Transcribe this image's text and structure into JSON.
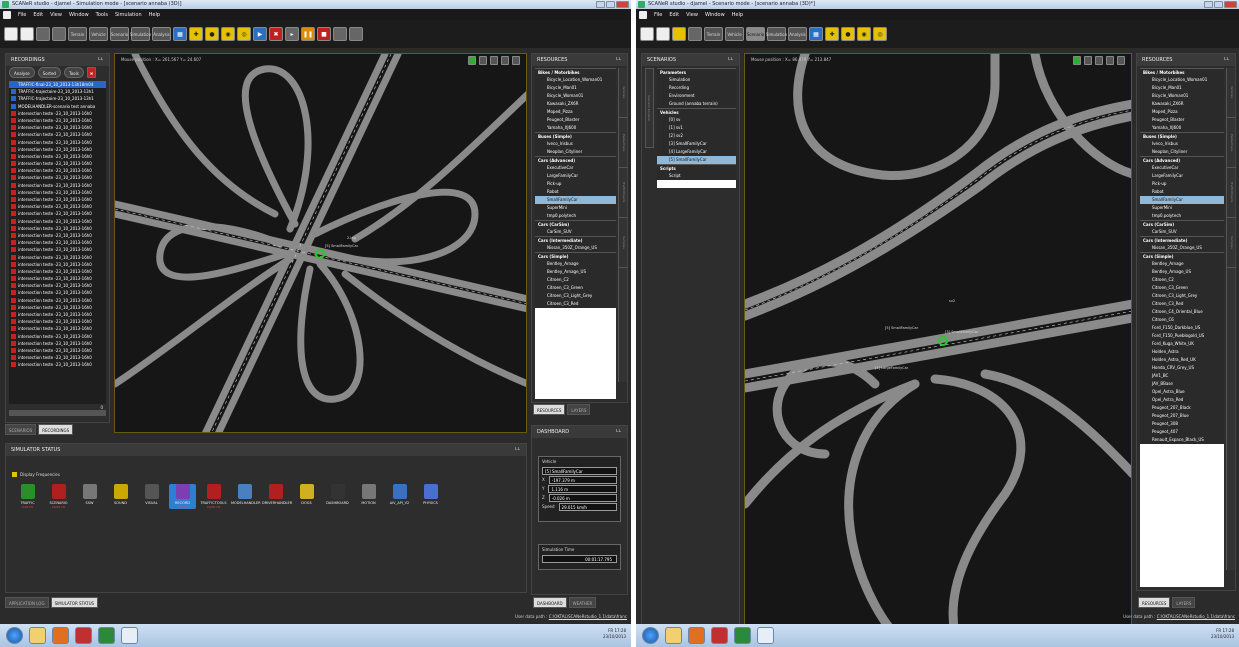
{
  "left": {
    "title": "SCANeR studio - djamel - Simulation mode - [scenario annaba (3D)]",
    "menu": [
      "File",
      "Edit",
      "View",
      "Window",
      "Tools",
      "Simulation",
      "Help"
    ],
    "toolbar_modes": [
      "Terrain",
      "Vehicle",
      "Scenario",
      "Simulation",
      "Analysis"
    ],
    "recordings": {
      "header": "RECORDINGS",
      "buttons": [
        "Analyse",
        "Sorted",
        "Tools"
      ],
      "items": [
        "TRAFFIC-final-23_10_2013-13h18m04",
        "TRAFFIC-trajectoire-23_10_2013-13h1",
        "TRAFFIC-trajectoire-23_10_2013-13h1",
        "MODELHANDLER-scenario test annaba",
        "intersection teste -23_10_2013-16h0",
        "intersection teste -23_10_2013-16h0",
        "intersection teste -23_10_2013-16h0",
        "intersection teste -23_10_2013-16h0",
        "intersection teste -23_10_2013-16h0",
        "intersection teste -23_10_2013-16h0",
        "intersection teste -23_10_2013-16h0",
        "intersection teste -23_10_2013-16h0",
        "intersection teste -23_10_2013-16h0",
        "intersection teste -23_10_2013-16h0",
        "intersection teste -23_10_2013-16h0",
        "intersection teste -23_10_2013-16h0",
        "intersection teste -23_10_2013-16h0",
        "intersection teste -23_10_2013-16h0",
        "intersection teste -23_10_2013-16h0",
        "intersection teste -23_10_2013-16h0",
        "intersection teste -23_10_2013-16h0",
        "intersection teste -23_10_2013-16h0",
        "intersection teste -23_10_2013-16h0",
        "intersection teste -23_10_2013-16h0",
        "intersection teste -23_10_2013-16h0",
        "intersection teste -23_10_2013-16h0",
        "intersection teste -23_10_2013-16h0",
        "intersection teste -23_10_2013-16h0",
        "intersection teste -23_10_2013-16h0",
        "intersection teste -23_10_2013-16h0",
        "intersection teste -23_10_2013-16h0",
        "intersection teste -23_10_2013-16h0",
        "intersection teste -23_10_2013-16h0",
        "intersection teste -23_10_2013-16h0",
        "intersection teste -23_10_2013-16h0",
        "intersection teste -23_10_2013-16h0",
        "intersection teste -23_10_2013-16h0",
        "intersection teste -23_10_2013-16h0",
        "intersection teste -23_10_2013-16h0",
        "intersection teste -23_10_2013-16h0"
      ],
      "scroll_value": "0"
    },
    "left_tabs": [
      "SCENARIOS",
      "RECORDINGS"
    ],
    "mouse_position": "Mouse position :  X= 261.567    Y= 24.607",
    "scene_labels": [
      "2.lag",
      "[5] SmallFamilyCar"
    ],
    "resources": {
      "header": "RESOURCES",
      "groups": [
        {
          "name": "Bikes / Motorbikes",
          "items": [
            "Bicycle_Location_Woman01",
            "Bicycle_Man01",
            "Bicycle_Woman01",
            "Kawasaki_ZX6R",
            "Moped_Pizza",
            "Peugeot_Blaster",
            "Yamaha_XJ600"
          ]
        },
        {
          "name": "Buses (Simple)",
          "items": [
            "Iveco_Irisbus",
            "Neoplan_Cityliner"
          ]
        },
        {
          "name": "Cars (Advanced)",
          "items": [
            "ExecutiveCar",
            "LargeFamilyCar",
            "Pick-up",
            "Robot",
            "SmallFamilyCar",
            "SuperMini",
            "tmp0.polytech"
          ]
        },
        {
          "name": "Cars (CarSim)",
          "items": [
            "CarSim_SUV"
          ]
        },
        {
          "name": "Cars (Intermediate)",
          "items": [
            "Nissan_350Z_Orange_US"
          ]
        },
        {
          "name": "Cars (Simple)",
          "items": [
            "Bentley_Arnage",
            "Bentley_Arnage_US",
            "Citroen_C2",
            "Citroen_C3_Green",
            "Citroen_C3_Light_Grey",
            "Citroen_C3_Red"
          ]
        }
      ],
      "selected": "SmallFamilyCar",
      "vtabs": [
        "Vehicles",
        "Pedestrians",
        "TrafficObjects",
        "Samples"
      ],
      "tabs": [
        "RESOURCES",
        "LAYERS"
      ]
    },
    "simulator": {
      "header": "SIMULATOR STATUS",
      "display_freq": "Display Frequencies",
      "modules": [
        {
          "name": "TRAFFIC",
          "hz": "4.00 Hz",
          "color": "#2a8f2a"
        },
        {
          "name": "SCENARIO",
          "hz": "20/20 Hz",
          "color": "#b02020"
        },
        {
          "name": "SSW",
          "hz": "",
          "color": "#777777"
        },
        {
          "name": "SOUND",
          "hz": "",
          "color": "#caa800"
        },
        {
          "name": "VISUAL",
          "hz": "",
          "color": "#555555"
        },
        {
          "name": "RECORD",
          "hz": "100 Hz",
          "color": "#7a3fb0"
        },
        {
          "name": "TRAFFICTOOLS",
          "hz": "20/20 Hz",
          "color": "#b02020"
        },
        {
          "name": "MODELHANDLER",
          "hz": "",
          "color": "#4a80c0"
        },
        {
          "name": "DRIVERHANDLER",
          "hz": "",
          "color": "#b02020"
        },
        {
          "name": "DOGS",
          "hz": "",
          "color": "#d0b020"
        },
        {
          "name": "DASHBOARD",
          "hz": "",
          "color": "#333333"
        },
        {
          "name": "MOTION",
          "hz": "",
          "color": "#777777"
        },
        {
          "name": "AIV_API_V2",
          "hz": "",
          "color": "#3a70c0"
        },
        {
          "name": "PHYSICS",
          "hz": "",
          "color": "#4a6fd0"
        }
      ],
      "tabs": [
        "APPLICATION LOG",
        "SIMULATOR STATUS"
      ]
    },
    "dashboard": {
      "header": "DASHBOARD",
      "vehicle_label": "Vehicle",
      "vehicle": "[5] SmallFamilyCar",
      "x_label": "X",
      "x": "-197.379 m",
      "y_label": "Y",
      "y": "1.116 m",
      "z_label": "Z",
      "z": "-0.026 m",
      "speed_label": "Speed",
      "speed": "29.015 km/h",
      "time_label": "Simulation Time",
      "time": "00:01:17.795",
      "tabs": [
        "DASHBOARD",
        "WEATHER"
      ]
    },
    "user_path_label": "User data path : ",
    "user_path": "C:\\OKTAL\\SCANeRstudio_1.1\\data\\franc",
    "tray": {
      "lang": "FR",
      "time": "17:28",
      "date": "23/10/2013"
    }
  },
  "right": {
    "title": "SCANeR studio - djamel - Scenario mode - [scenario annaba (3D)*]",
    "menu": [
      "File",
      "Edit",
      "View",
      "Window",
      "Help"
    ],
    "toolbar_modes": [
      "Terrain",
      "Vehicle",
      "Scenario",
      "Simulation",
      "Analysis"
    ],
    "scenarios": {
      "header": "SCENARIOS",
      "tree": [
        {
          "label": "Parameters",
          "type": "cat"
        },
        {
          "label": "Simulation",
          "type": "it"
        },
        {
          "label": "Recording",
          "type": "it"
        },
        {
          "label": "Environment",
          "type": "it"
        },
        {
          "label": "Ground (annaba terrain)",
          "type": "it"
        },
        {
          "label": "Vehicles",
          "type": "cat"
        },
        {
          "label": "[0] sv",
          "type": "it"
        },
        {
          "label": "[1] sv1",
          "type": "it"
        },
        {
          "label": "[2] sv2",
          "type": "it"
        },
        {
          "label": "[3] SmallFamilyCar",
          "type": "it"
        },
        {
          "label": "[4] LargeFamilyCar",
          "type": "it"
        },
        {
          "label": "[5] SmallFamilyCar",
          "type": "sel"
        },
        {
          "label": "Scripts",
          "type": "cat"
        },
        {
          "label": "Script",
          "type": "it"
        }
      ],
      "vtabs": [
        "Scenario Explorer"
      ]
    },
    "mouse_position": "Mouse position :  X= 86.479    Y= 213.847",
    "scene_labels": [
      "[3] SmallFamilyCar",
      "[5] SmallFamilyCar",
      "[4] LargeFamilyCar",
      "sv2"
    ],
    "resources": {
      "header": "RESOURCES",
      "groups": [
        {
          "name": "Bikes / Motorbikes",
          "items": [
            "Bicycle_Location_Woman01",
            "Bicycle_Man01",
            "Bicycle_Woman01",
            "Kawasaki_ZX6R",
            "Moped_Pizza",
            "Peugeot_Blaster",
            "Yamaha_XJ600"
          ]
        },
        {
          "name": "Buses (Simple)",
          "items": [
            "Iveco_Irisbus",
            "Neoplan_Cityliner"
          ]
        },
        {
          "name": "Cars (Advanced)",
          "items": [
            "ExecutiveCar",
            "LargeFamilyCar",
            "Pick-up",
            "Robot",
            "SmallFamilyCar",
            "SuperMini",
            "tmp0.polytech"
          ]
        },
        {
          "name": "Cars (CarSim)",
          "items": [
            "CarSim_SUV"
          ]
        },
        {
          "name": "Cars (Intermediate)",
          "items": [
            "Nissan_350Z_Orange_US"
          ]
        },
        {
          "name": "Cars (Simple)",
          "items": [
            "Bentley_Arnage",
            "Bentley_Arnage_US",
            "Citroen_C2",
            "Citroen_C3_Green",
            "Citroen_C3_Light_Grey",
            "Citroen_C3_Red",
            "Citroen_C4_Oriental_Blue",
            "Citroen_C6",
            "Ford_F150_Darkblue_US",
            "Ford_F150_Pueblogold_US",
            "Ford_Kuga_White_UK",
            "Holden_Astra",
            "Holden_Astra_Red_UK",
            "Honda_CRV_Grey_US",
            "JAV1_BC",
            "JAV_BBase",
            "Opel_Astra_Blue",
            "Opel_Astra_Red",
            "Peugeot_207_Black",
            "Peugeot_207_Blue",
            "Peugeot_308",
            "Peugeot_407",
            "Renault_Espace_Black_US"
          ]
        }
      ],
      "selected": "SmallFamilyCar",
      "vtabs": [
        "Vehicles",
        "Pedestrians",
        "TrafficObjects",
        "Samples"
      ],
      "tabs": [
        "RESOURCES",
        "LAYERS"
      ]
    },
    "user_path_label": "User data path : ",
    "user_path": "C:\\OKTAL\\SCANeRstudio_1.1\\data\\franc",
    "tray": {
      "lang": "FR",
      "time": "17:28",
      "date": "23/10/2013"
    }
  }
}
